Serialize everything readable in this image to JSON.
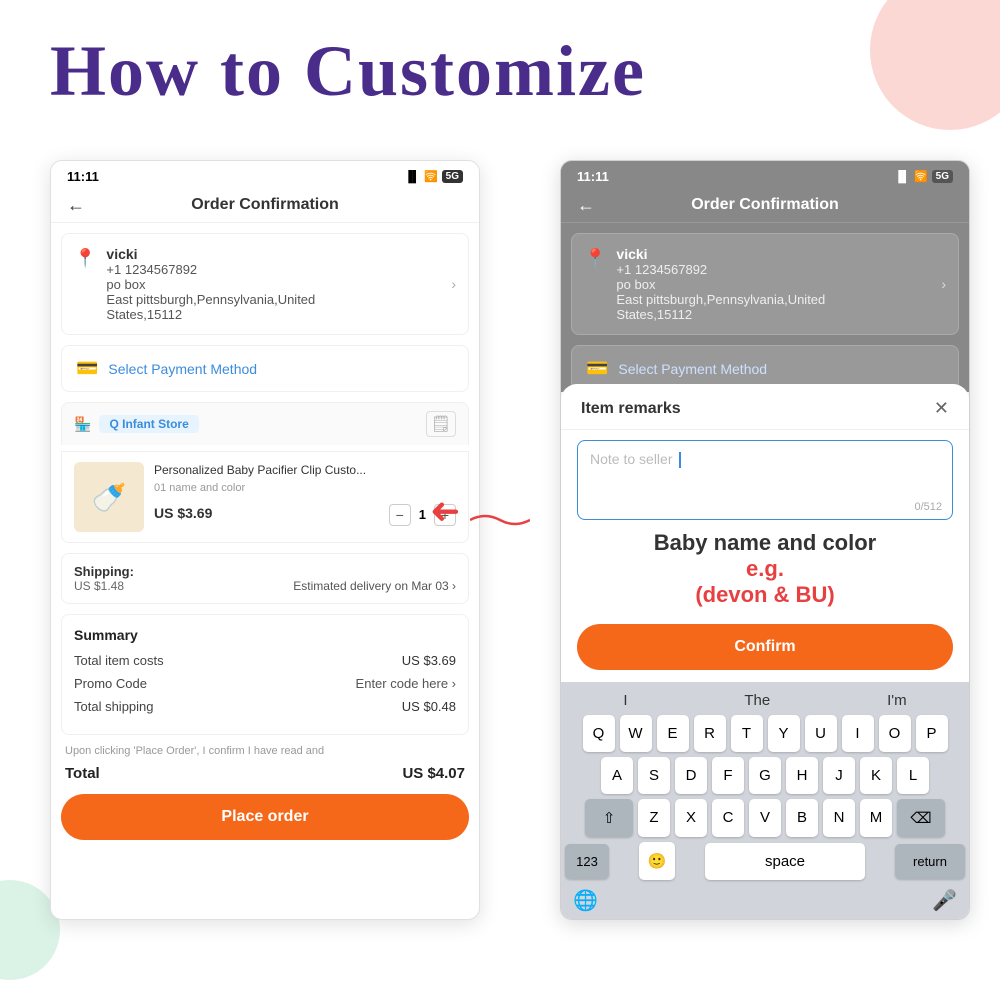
{
  "page": {
    "title": "How to Customize",
    "title_color": "#4a2c8a"
  },
  "left_phone": {
    "status_bar": {
      "time": "11:11",
      "signal": "▐▌▌",
      "wifi": "WiFi",
      "carrier": "5G"
    },
    "nav": {
      "back_icon": "←",
      "title": "Order Confirmation"
    },
    "address": {
      "icon": "📍",
      "name": "vicki",
      "phone": "+1 1234567892",
      "line1": "po box",
      "line2": "East pittsburgh,Pennsylvania,United",
      "line3": "States,15112",
      "chevron": "›"
    },
    "payment": {
      "icon": "💳",
      "text": "Select Payment Method"
    },
    "store": {
      "icon": "🏪",
      "name": "Q Infant Store",
      "note_icon": "📝"
    },
    "product": {
      "name": "Personalized Baby Pacifier Clip Custo...",
      "variant": "01 name and color",
      "price": "US $3.69",
      "qty": "1"
    },
    "shipping": {
      "label": "Shipping:",
      "cost": "US $1.48",
      "delivery": "Estimated delivery on Mar 03 ›"
    },
    "summary": {
      "title": "Summary",
      "item_costs_label": "Total item costs",
      "item_costs_value": "US $3.69",
      "promo_label": "Promo Code",
      "promo_value": "Enter code here ›",
      "shipping_label": "Total shipping",
      "shipping_value": "US $0.48"
    },
    "disclaimer": "Upon clicking 'Place Order', I confirm I have read and",
    "total": {
      "label": "Total",
      "value": "US $4.07"
    },
    "place_order_btn": "Place order"
  },
  "right_phone": {
    "status_bar": {
      "time": "11:11",
      "signal": "▐▌▌",
      "wifi": "WiFi",
      "carrier": "5G"
    },
    "nav": {
      "back_icon": "←",
      "title": "Order Confirmation"
    },
    "address": {
      "icon": "📍",
      "name": "vicki",
      "phone": "+1 1234567892",
      "line1": "po box",
      "line2": "East pittsburgh,Pennsylvania,United",
      "line3": "States,15112",
      "chevron": "›"
    },
    "payment_text": "Select Payment Method"
  },
  "modal": {
    "title": "Item remarks",
    "close_icon": "✕",
    "placeholder": "Note to seller",
    "counter": "0/512",
    "hint_main": "Baby name and color",
    "hint_eg": "e.g.",
    "hint_example": "(devon & BU)",
    "confirm_btn": "Confirm"
  },
  "keyboard": {
    "suggestions": [
      "I",
      "The",
      "I'm"
    ],
    "row1": [
      "Q",
      "W",
      "E",
      "R",
      "T",
      "Y",
      "U",
      "I",
      "O",
      "P"
    ],
    "row2": [
      "A",
      "S",
      "D",
      "F",
      "G",
      "H",
      "J",
      "K",
      "L"
    ],
    "row3": [
      "Z",
      "X",
      "C",
      "V",
      "B",
      "N",
      "M"
    ],
    "numbers_btn": "123",
    "space_btn": "space",
    "return_btn": "return",
    "delete_icon": "⌫",
    "shift_icon": "⇧",
    "emoji_icon": "🙂",
    "globe_icon": "🌐",
    "mic_icon": "🎤"
  }
}
